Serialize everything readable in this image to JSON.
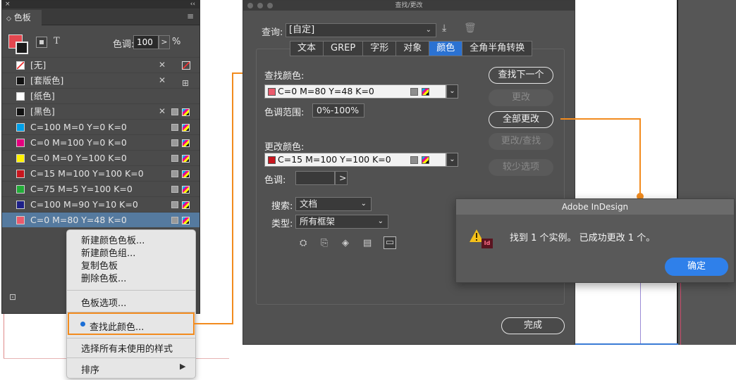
{
  "swatches_panel": {
    "close_glyph": "×",
    "collapse_glyph": "‹‹",
    "tab_label": "色板",
    "tab_arrow": "◇",
    "menu_glyph": "≡",
    "format_text_glyph": "T",
    "tint_label": "色调:",
    "tint_value": "100",
    "tint_arrow": ">",
    "tint_pct": "%",
    "rows": [
      {
        "name": "[无]",
        "color": "#ffffff",
        "kind": "none"
      },
      {
        "name": "[套版色]",
        "color": "#1a1a1a",
        "kind": "registration"
      },
      {
        "name": "[纸色]",
        "color": "#ffffff",
        "kind": "plain"
      },
      {
        "name": "[黑色]",
        "color": "#111111",
        "kind": "process-locked"
      },
      {
        "name": "C=100 M=0 Y=0 K=0",
        "color": "#00a0e9",
        "kind": "process"
      },
      {
        "name": "C=0 M=100 Y=0 K=0",
        "color": "#e4007f",
        "kind": "process"
      },
      {
        "name": "C=0 M=0 Y=100 K=0",
        "color": "#fff100",
        "kind": "process"
      },
      {
        "name": "C=15 M=100 Y=100 K=0",
        "color": "#c8161e",
        "kind": "process"
      },
      {
        "name": "C=75 M=5 Y=100 K=0",
        "color": "#22ac38",
        "kind": "process"
      },
      {
        "name": "C=100 M=90 Y=10 K=0",
        "color": "#1d2088",
        "kind": "process"
      },
      {
        "name": "C=0 M=80 Y=48 K=0",
        "color": "#ea5a6c",
        "kind": "process",
        "selected": true
      }
    ]
  },
  "context_menu": {
    "items": [
      "新建颜色色板...",
      "新建颜色组...",
      "复制色板",
      "删除色板..."
    ],
    "swatch_options": "色板选项...",
    "find_this_color": "查找此颜色...",
    "select_unused": "选择所有未使用的样式",
    "sort": "排序",
    "sort_arrow": "▶"
  },
  "find_change": {
    "window_title": "查找/更改",
    "query_label": "查询:",
    "query_value": "[自定]",
    "tabs": [
      {
        "label": "文本",
        "active": false
      },
      {
        "label": "GREP",
        "active": false
      },
      {
        "label": "字形",
        "active": false
      },
      {
        "label": "对象",
        "active": false
      },
      {
        "label": "颜色",
        "active": true
      },
      {
        "label": "全角半角转换",
        "active": false
      }
    ],
    "find_color_label": "查找颜色:",
    "find_color_value": "C=0 M=80 Y=48 K=0",
    "find_color_chip": "#ea5a6c",
    "tint_range_label": "色调范围:",
    "tint_range_value": "0%-100%",
    "change_color_label": "更改颜色:",
    "change_color_value": "C=15 M=100 Y=100 K=0",
    "change_color_chip": "#c8161e",
    "change_tint_label": "色调:",
    "change_tint_arrow": ">",
    "search_label": "搜索:",
    "search_value": "文档",
    "type_label": "类型:",
    "type_value": "所有框架",
    "buttons": {
      "find_next": "查找下一个",
      "change": "更改",
      "change_all": "全部更改",
      "change_find": "更改/查找",
      "fewer_options": "较少选项",
      "done": "完成"
    },
    "chevron": "⌄"
  },
  "alert": {
    "title": "Adobe InDesign",
    "message": "找到 1 个实例。 已成功更改 1 个。",
    "ok": "确定",
    "app_badge": "Id"
  },
  "colors": {
    "accent_orange": "#f28b1e",
    "active_tab_blue": "#2b72d2",
    "ok_button_blue": "#2f80ea"
  }
}
